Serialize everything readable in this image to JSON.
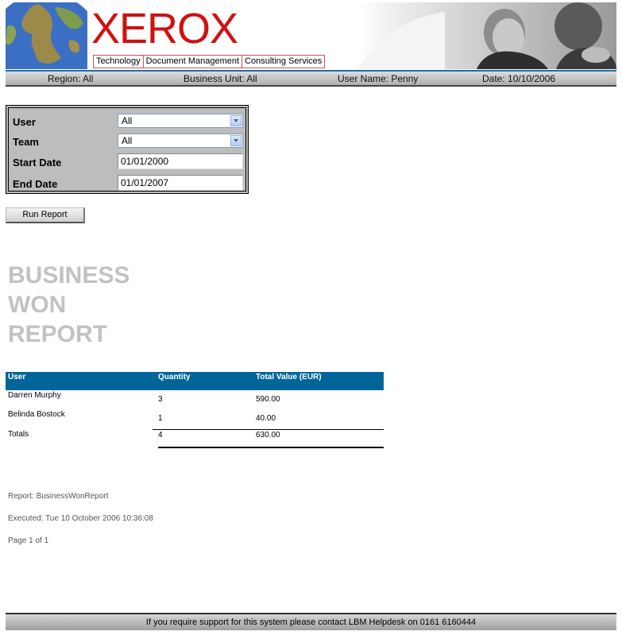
{
  "header": {
    "logo_text": "XEROX",
    "tabs": [
      "Technology",
      "Document Management",
      "Consulting Services"
    ]
  },
  "infobar": {
    "region": "Region: All",
    "business_unit": "Business Unit: All",
    "user_name": "User Name: Penny",
    "date": "Date: 10/10/2006"
  },
  "filters": {
    "user_label": "User",
    "user_value": "All",
    "team_label": "Team",
    "team_value": "All",
    "start_label": "Start Date",
    "start_value": "01/01/2000",
    "end_label": "End Date",
    "end_value": "01/01/2007",
    "run_button": "Run Report"
  },
  "report": {
    "title_lines": [
      "BUSINESS",
      "WON",
      "REPORT"
    ],
    "columns": [
      "User",
      "Quantity",
      "Total Value (EUR)"
    ],
    "rows": [
      {
        "user": "Darren Murphy",
        "quantity": "3",
        "total": "590.00"
      },
      {
        "user": "Belinda Bostock",
        "quantity": "1",
        "total": "40.00"
      }
    ],
    "totals": {
      "label": "Totals",
      "quantity": "4",
      "total": "630.00"
    }
  },
  "meta": {
    "report_name": "Report: BusinessWonReport",
    "executed": "Executed: Tue 10 October 2006 10:36:08",
    "page": "Page 1 of 1"
  },
  "support_text": "If you require support for this system please contact LBM Helpdesk on 0161 6160444",
  "colors": {
    "logo": "#d11010",
    "table_header": "#006699",
    "title_gray": "#c2c2c2"
  }
}
